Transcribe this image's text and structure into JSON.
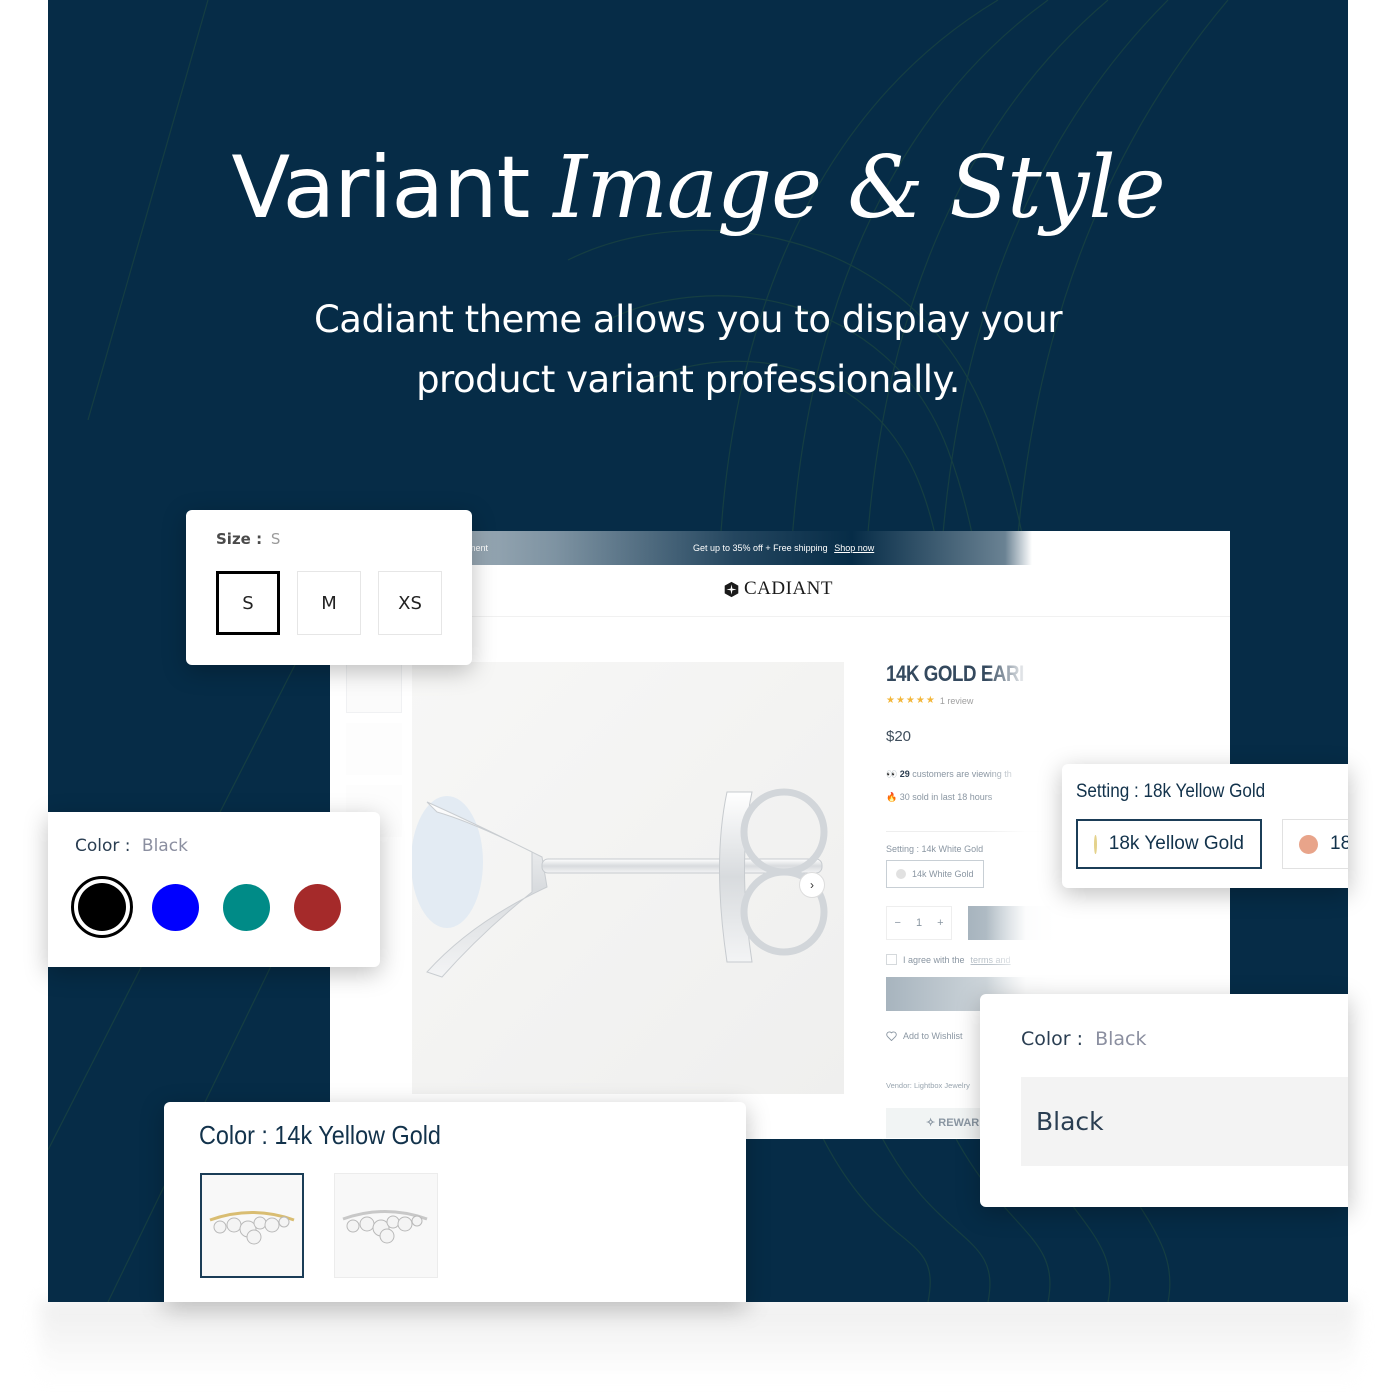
{
  "hero": {
    "title_plain": "Variant",
    "title_italic": "Image & Style",
    "subtitle_line1": "Cadiant theme allows you to display your",
    "subtitle_line2": "product variant professionally.",
    "background_color": "#062c47"
  },
  "store": {
    "announcement": {
      "left_text": "ment",
      "promo_text": "Get up to 35% off + Free shipping",
      "link_text": "Shop now"
    },
    "brand": "CADIANT",
    "product": {
      "title": "14K GOLD EARI",
      "stars": "★★★★★",
      "rating": 5,
      "reviews": "1 review",
      "price": "$20",
      "viewing_count": "29",
      "viewing_text": "customers are viewing th",
      "sold_text": "30 sold in last 18 hours",
      "setting_label": "Setting :",
      "setting_value": "14k White Gold",
      "setting_option": "14k White Gold",
      "quantity": "1",
      "qty_minus": "−",
      "qty_plus": "+",
      "agree_text": "I agree with the",
      "agree_link": "terms and",
      "wishlist": "Add to Wishlist",
      "vendor_label": "Vendor:",
      "vendor_value": "Lightbox Jewelry",
      "reward_text": "REWAR",
      "next_arrow": "›"
    }
  },
  "size_card": {
    "label": "Size :",
    "value": "S",
    "options": [
      {
        "label": "S",
        "selected": true
      },
      {
        "label": "M",
        "selected": false
      },
      {
        "label": "XS",
        "selected": false
      }
    ]
  },
  "color_card": {
    "label": "Color :",
    "value": "Black",
    "swatches": [
      {
        "name": "Black",
        "color": "#000000",
        "selected": true
      },
      {
        "name": "Blue",
        "color": "#0000ff",
        "selected": false
      },
      {
        "name": "Teal",
        "color": "#008b87",
        "selected": false
      },
      {
        "name": "Red",
        "color": "#a52a2a",
        "selected": false
      }
    ]
  },
  "setting_card": {
    "label": "Setting :",
    "value": "18k Yellow Gold",
    "options": [
      {
        "label": "18k Yellow Gold",
        "color": "#e4d28c",
        "selected": true
      },
      {
        "label": "18",
        "color": "#e8a48a",
        "selected": false
      }
    ]
  },
  "dropdown_card": {
    "label": "Color :",
    "value": "Black",
    "selected_option": "Black"
  },
  "image_card": {
    "label": "Color : 14k Yellow Gold",
    "options": [
      {
        "name": "14k Yellow Gold ring",
        "metal_color": "#d9bd72",
        "selected": true
      },
      {
        "name": "14k White Gold ring",
        "metal_color": "#c8c8c8",
        "selected": false
      }
    ]
  }
}
